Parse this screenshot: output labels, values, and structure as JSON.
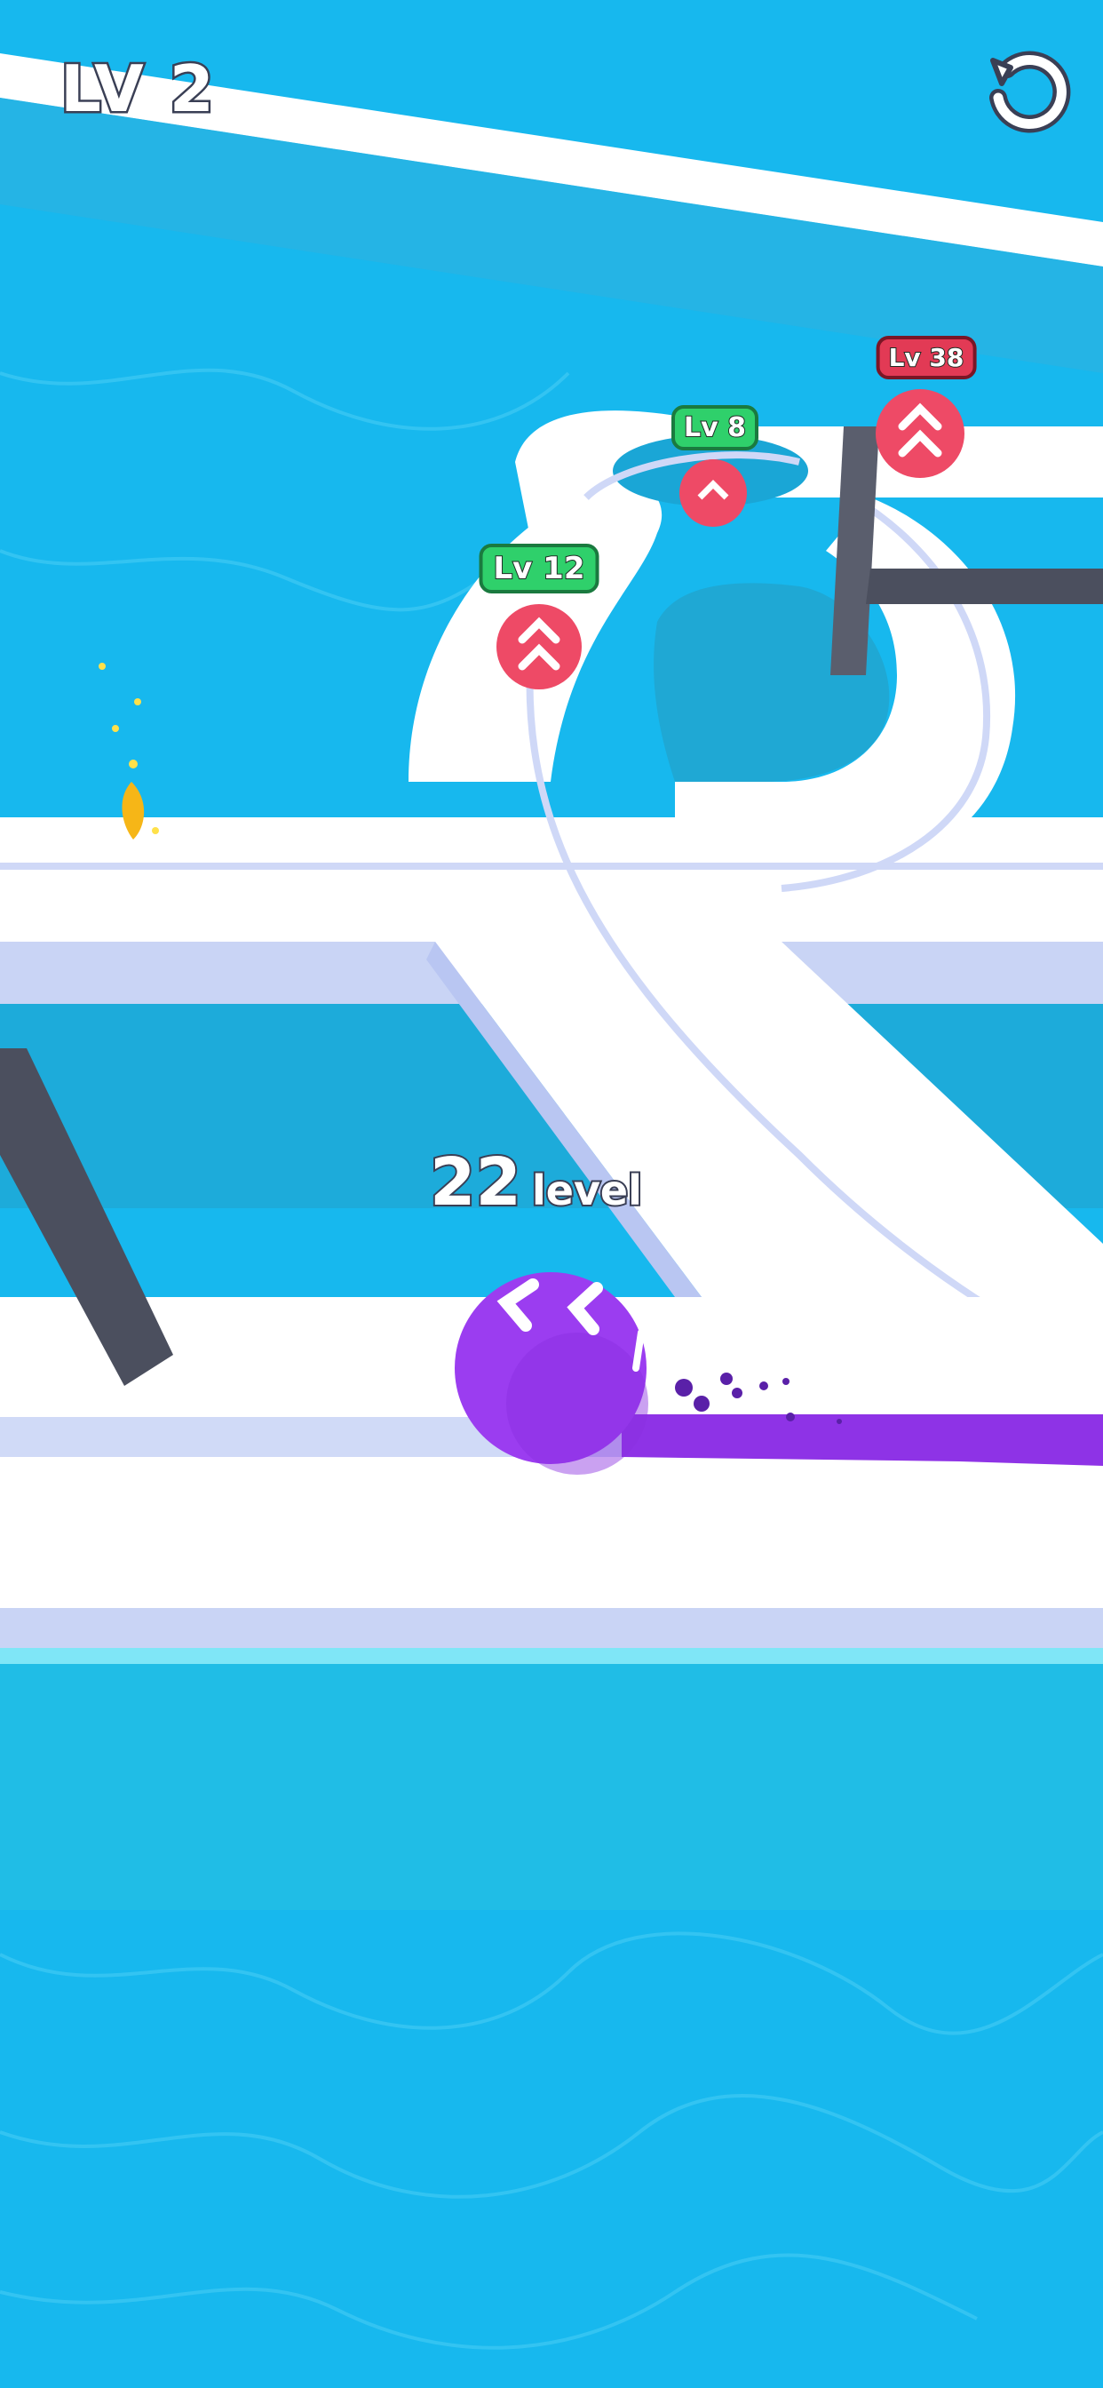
{
  "hud": {
    "level_label": "LV 2"
  },
  "icons": {
    "restart": "restart-icon"
  },
  "player": {
    "level_number": "22",
    "level_word": "level",
    "color": "#9b3df0"
  },
  "enemies": [
    {
      "label": "Lv 8",
      "badge_color": "green"
    },
    {
      "label": "Lv 38",
      "badge_color": "red"
    },
    {
      "label": "Lv 12",
      "badge_color": "green"
    }
  ],
  "colors": {
    "water": "#17b8ee",
    "track": "#ffffff",
    "track_edge": "#c9d4f5",
    "enemy_ball": "#ee4a66",
    "wall": "#4b4f5e",
    "paint_trail": "#8e33e6"
  }
}
